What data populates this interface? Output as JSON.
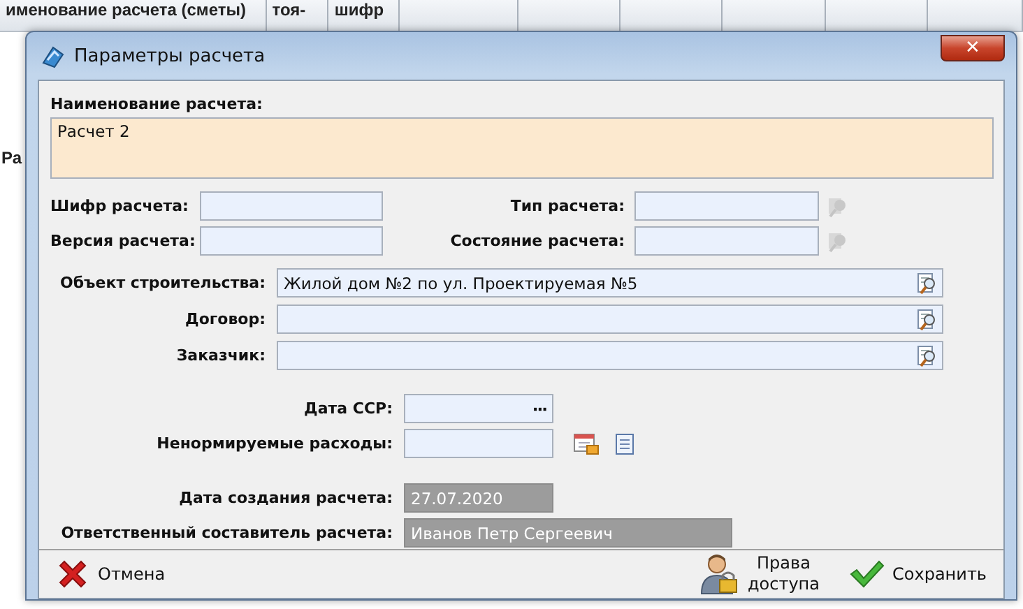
{
  "background_table": {
    "columns": [
      "именование расчета (сметы)",
      "тоя-",
      "шифр"
    ],
    "side_text": "Ра"
  },
  "dialog": {
    "title": "Параметры расчета",
    "close_glyph": "✕",
    "name_field": {
      "label": "Наименование расчета:",
      "value": "Расчет 2"
    },
    "pair_rows": [
      {
        "left": {
          "label": "Шифр расчета:"
        },
        "right": {
          "label": "Тип расчета:",
          "picker_disabled": true
        }
      },
      {
        "left": {
          "label": "Версия расчета:"
        },
        "right": {
          "label": "Состояние расчета:",
          "picker_disabled": true
        }
      }
    ],
    "lookup_fields": [
      {
        "label": "Объект строительства:",
        "value": "Жилой дом №2 по ул. Проектируемая №5"
      },
      {
        "label": "Договор:"
      },
      {
        "label": "Заказчик:"
      }
    ],
    "extra_fields": [
      {
        "label": "Дата ССР:",
        "kind": "ellipsis",
        "button": "···"
      },
      {
        "label": "Ненормируемые расходы:",
        "kind": "icons"
      }
    ],
    "info_fields": [
      {
        "label": "Дата создания расчета:",
        "value": "27.07.2020",
        "kind": "date",
        "disabled": true
      },
      {
        "label": "Ответственный составитель расчета:",
        "value": "Иванов Петр Сергеевич",
        "kind": "text",
        "disabled": true
      }
    ],
    "buttons": [
      {
        "label": "Отмена",
        "kind": "cancel"
      },
      {
        "label": "Права\nдоступа",
        "kind": "access"
      },
      {
        "label": "Сохранить",
        "kind": "save"
      }
    ]
  }
}
